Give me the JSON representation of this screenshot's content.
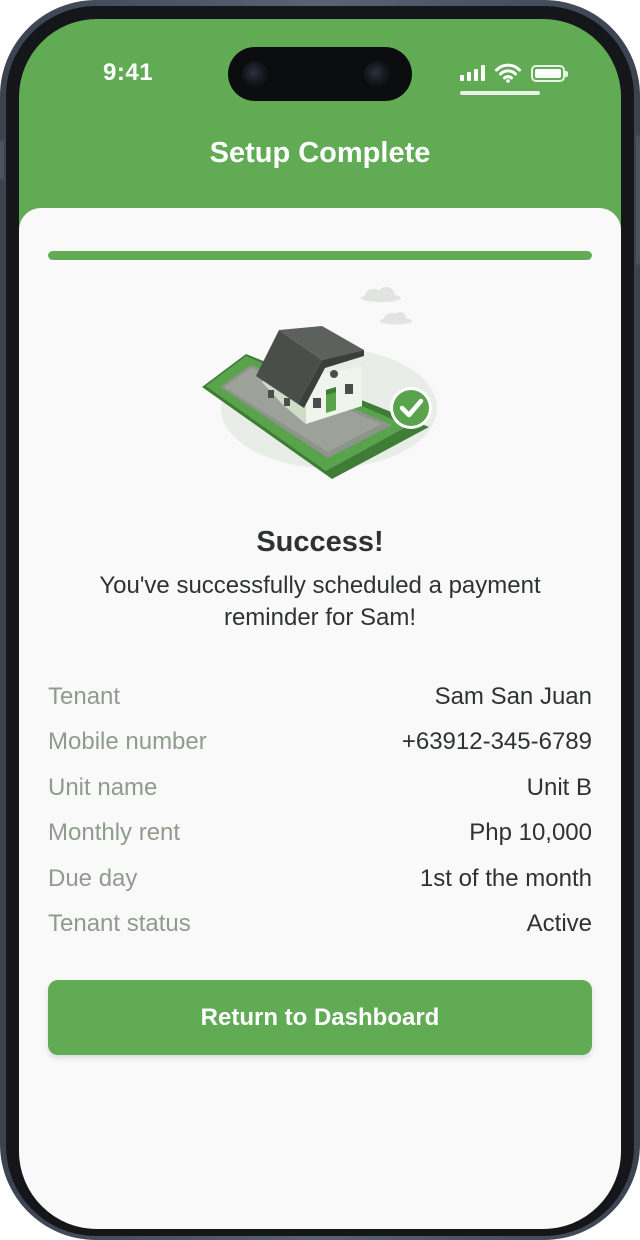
{
  "status_bar": {
    "time": "9:41",
    "battery_level": 1.0,
    "signal_bars": 4
  },
  "header": {
    "title": "Setup Complete"
  },
  "progress": {
    "value": 1.0
  },
  "illustration": {
    "icon": "house-on-phone-check-icon"
  },
  "success": {
    "title": "Success!",
    "message": "You've successfully scheduled a payment reminder  for Sam!"
  },
  "details": [
    {
      "label": "Tenant",
      "value": "Sam San Juan"
    },
    {
      "label": "Mobile number",
      "value": "+63912-345-6789"
    },
    {
      "label": "Unit name",
      "value": "Unit B"
    },
    {
      "label": "Monthly rent",
      "value": "Php 10,000"
    },
    {
      "label": "Due day",
      "value": "1st  of the month"
    },
    {
      "label": "Tenant status",
      "value": "Active"
    }
  ],
  "actions": {
    "return_label": "Return to Dashboard"
  },
  "colors": {
    "brand_green": "#62ab55",
    "text_dark": "#2f3330",
    "label_gray": "#8f9b8d",
    "card_bg": "#f9f9f9"
  }
}
